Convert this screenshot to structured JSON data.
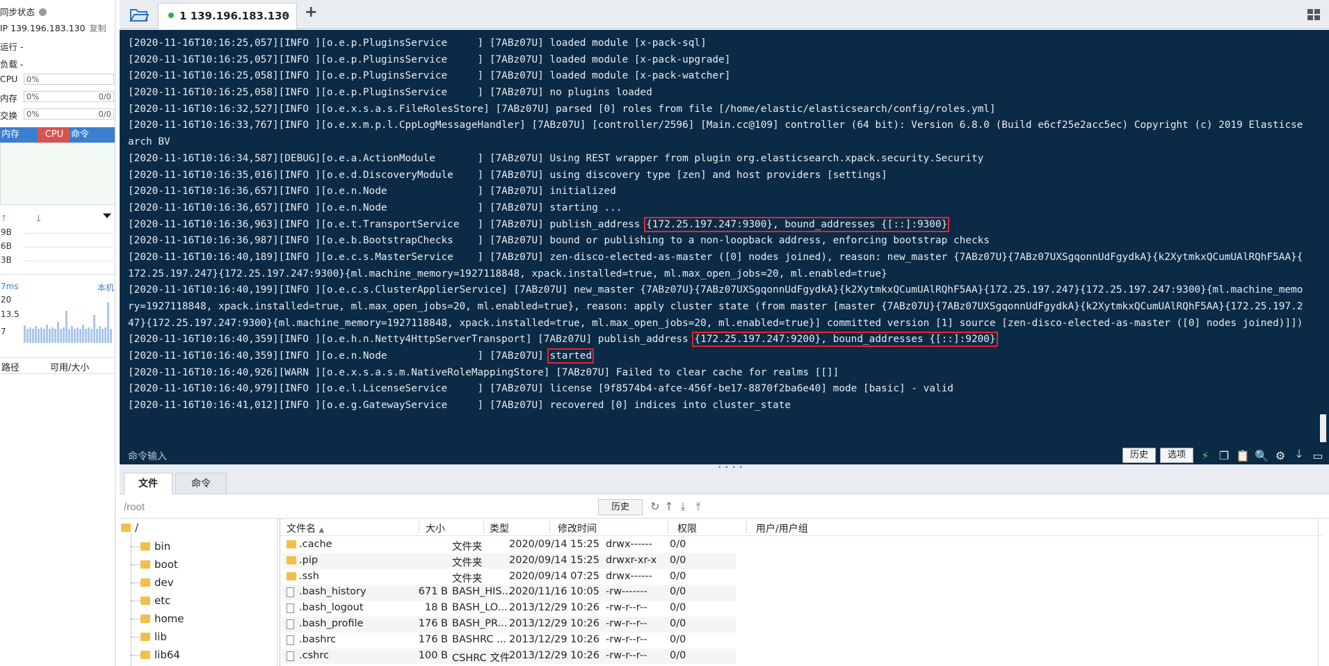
{
  "sidebar": {
    "sync_label": "同步状态",
    "ip_label": "IP 139.196.183.130",
    "copy_label": "复制",
    "run_label": "运行 -",
    "load_label": "负载 -",
    "cpu": {
      "label": "CPU",
      "value": "0%"
    },
    "mem": {
      "label": "内存",
      "value": "0%",
      "extra": "0/0"
    },
    "swap": {
      "label": "交换",
      "value": "0%",
      "extra": "0/0"
    },
    "metric_tabs": [
      {
        "label": "内存",
        "color": "#3a7fd0"
      },
      {
        "label": "CPU",
        "color": "#d9534f"
      },
      {
        "label": "命令",
        "color": "#3a7fd0"
      }
    ],
    "net_labels": [
      "9B",
      "6B",
      "3B"
    ],
    "ping": {
      "ms": "7ms",
      "host": "本机",
      "labels": [
        "20",
        "13.5",
        "7"
      ]
    },
    "disk_cols": [
      "路径",
      "可用/大小"
    ]
  },
  "tabs": [
    {
      "label": "1 139.196.183.130",
      "close": "✕",
      "status_color": "#22b14c"
    }
  ],
  "add_tab": "+",
  "terminal": {
    "lines": [
      [
        "[2020-11-16T10:16:25,057][INFO ][o.e.p.PluginsService     ] [7ABz07U] loaded module [x-pack-sql]"
      ],
      [
        "[2020-11-16T10:16:25,057][INFO ][o.e.p.PluginsService     ] [7ABz07U] loaded module [x-pack-upgrade]"
      ],
      [
        "[2020-11-16T10:16:25,058][INFO ][o.e.p.PluginsService     ] [7ABz07U] loaded module [x-pack-watcher]"
      ],
      [
        "[2020-11-16T10:16:25,058][INFO ][o.e.p.PluginsService     ] [7ABz07U] no plugins loaded"
      ],
      [
        "[2020-11-16T10:16:32,527][INFO ][o.e.x.s.a.s.FileRolesStore] [7ABz07U] parsed [0] roles from file [/home/elastic/elasticsearch/config/roles.yml]"
      ],
      [
        "[2020-11-16T10:16:33,767][INFO ][o.e.x.m.p.l.CppLogMessageHandler] [7ABz07U] [controller/2596] [Main.cc@109] controller (64 bit): Version 6.8.0 (Build e6cf25e2acc5ec) Copyright (c) 2019 Elasticse"
      ],
      [
        "arch BV"
      ],
      [
        "[2020-11-16T10:16:34,587][DEBUG][o.e.a.ActionModule       ] [7ABz07U] Using REST wrapper from plugin org.elasticsearch.xpack.security.Security"
      ],
      [
        "[2020-11-16T10:16:35,016][INFO ][o.e.d.DiscoveryModule    ] [7ABz07U] using discovery type [zen] and host providers [settings]"
      ],
      [
        "[2020-11-16T10:16:36,657][INFO ][o.e.n.Node               ] [7ABz07U] initialized"
      ],
      [
        "[2020-11-16T10:16:36,657][INFO ][o.e.n.Node               ] [7ABz07U] starting ..."
      ],
      [
        "[2020-11-16T10:16:36,963][INFO ][o.e.t.TransportService   ] [7ABz07U] publish_address ",
        "{172.25.197.247:9300}, bound_addresses {[::]:9300}"
      ],
      [
        "[2020-11-16T10:16:36,987][INFO ][o.e.b.BootstrapChecks    ] [7ABz07U] bound or publishing to a non-loopback address, enforcing bootstrap checks"
      ],
      [
        "[2020-11-16T10:16:40,189][INFO ][o.e.c.s.MasterService    ] [7ABz07U] zen-disco-elected-as-master ([0] nodes joined), reason: new_master {7ABz07U}{7ABz07UXSgqonnUdFgydkA}{k2XytmkxQCumUAlRQhF5AA}{"
      ],
      [
        "172.25.197.247}{172.25.197.247:9300}{ml.machine_memory=1927118848, xpack.installed=true, ml.max_open_jobs=20, ml.enabled=true}"
      ],
      [
        "[2020-11-16T10:16:40,199][INFO ][o.e.c.s.ClusterApplierService] [7ABz07U] new_master {7ABz07U}{7ABz07UXSgqonnUdFgydkA}{k2XytmkxQCumUAlRQhF5AA}{172.25.197.247}{172.25.197.247:9300}{ml.machine_memo"
      ],
      [
        "ry=1927118848, xpack.installed=true, ml.max_open_jobs=20, ml.enabled=true}, reason: apply cluster state (from master [master {7ABz07U}{7ABz07UXSgqonnUdFgydkA}{k2XytmkxQCumUAlRQhF5AA}{172.25.197.2"
      ],
      [
        "47}{172.25.197.247:9300}{ml.machine_memory=1927118848, xpack.installed=true, ml.max_open_jobs=20, ml.enabled=true}] committed version [1] source [zen-disco-elected-as-master ([0] nodes joined)]])"
      ],
      [
        "[2020-11-16T10:16:40,359][INFO ][o.e.h.n.Netty4HttpServerTransport] [7ABz07U] publish_address ",
        "{172.25.197.247:9200}, bound_addresses {[::]:9200}"
      ],
      [
        "[2020-11-16T10:16:40,359][INFO ][o.e.n.Node               ] [7ABz07U] ",
        "started"
      ],
      [
        "[2020-11-16T10:16:40,926][WARN ][o.e.x.s.a.s.m.NativeRoleMappingStore] [7ABz07U] Failed to clear cache for realms [[]]"
      ],
      [
        "[2020-11-16T10:16:40,979][INFO ][o.e.l.LicenseService     ] [7ABz07U] license [9f8574b4-afce-456f-be17-8870f2ba6e40] mode [basic] - valid"
      ],
      [
        "[2020-11-16T10:16:41,012][INFO ][o.e.g.GatewayService     ] [7ABz07U] recovered [0] indices into cluster_state"
      ]
    ],
    "input_placeholder": "命令输入",
    "history_btn": "历史",
    "options_btn": "选项"
  },
  "bottom_tabs": [
    {
      "label": "文件"
    },
    {
      "label": "命令"
    }
  ],
  "path": {
    "value": "/root",
    "history_btn": "历史"
  },
  "tree": {
    "root": "/",
    "items": [
      "bin",
      "boot",
      "dev",
      "etc",
      "home",
      "lib",
      "lib64"
    ]
  },
  "files": {
    "columns": [
      "文件名",
      "大小",
      "类型",
      "修改时间",
      "权限",
      "用户/用户组"
    ],
    "rows": [
      {
        "name": ".cache",
        "size": "",
        "type": "文件夹",
        "mtime": "2020/09/14 15:25",
        "perm": "drwx------",
        "owner": "0/0",
        "kind": "folder"
      },
      {
        "name": ".pip",
        "size": "",
        "type": "文件夹",
        "mtime": "2020/09/14 15:25",
        "perm": "drwxr-xr-x",
        "owner": "0/0",
        "kind": "folder"
      },
      {
        "name": ".ssh",
        "size": "",
        "type": "文件夹",
        "mtime": "2020/09/14 07:25",
        "perm": "drwx------",
        "owner": "0/0",
        "kind": "folder"
      },
      {
        "name": ".bash_history",
        "size": "671 B",
        "type": "BASH_HIS...",
        "mtime": "2020/11/16 10:05",
        "perm": "-rw-------",
        "owner": "0/0",
        "kind": "file"
      },
      {
        "name": ".bash_logout",
        "size": "18 B",
        "type": "BASH_LO...",
        "mtime": "2013/12/29 10:26",
        "perm": "-rw-r--r--",
        "owner": "0/0",
        "kind": "file"
      },
      {
        "name": ".bash_profile",
        "size": "176 B",
        "type": "BASH_PR...",
        "mtime": "2013/12/29 10:26",
        "perm": "-rw-r--r--",
        "owner": "0/0",
        "kind": "file"
      },
      {
        "name": ".bashrc",
        "size": "176 B",
        "type": "BASHRC ...",
        "mtime": "2013/12/29 10:26",
        "perm": "-rw-r--r--",
        "owner": "0/0",
        "kind": "file"
      },
      {
        "name": ".cshrc",
        "size": "100 B",
        "type": "CSHRC 文件",
        "mtime": "2013/12/29 10:26",
        "perm": "-rw-r--r--",
        "owner": "0/0",
        "kind": "file"
      }
    ]
  }
}
